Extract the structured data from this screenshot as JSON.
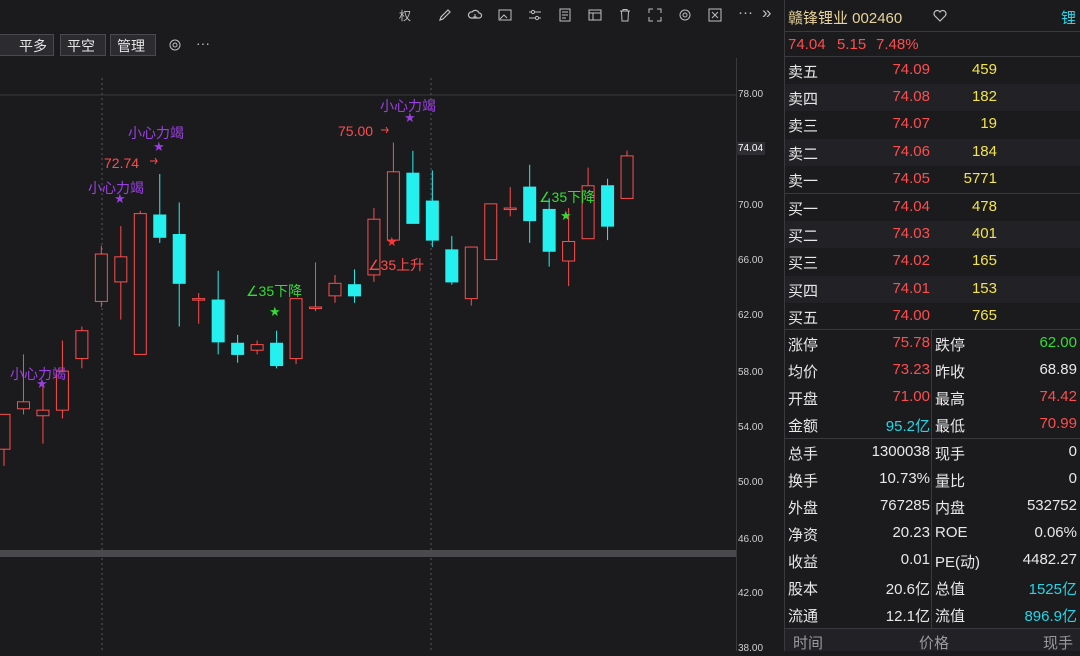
{
  "toolbar": {
    "quan_label": "权",
    "buttons": [
      "平多",
      "平空",
      "管理"
    ],
    "more_label": "···",
    "collapse_label": "»"
  },
  "colors": {
    "up": "#ff4d4d",
    "down": "#25f0f0",
    "signal_purple": "#9b40e0",
    "signal_green": "#33dd33",
    "signal_red": "#ff3333"
  },
  "axis": {
    "ticks": [
      "78.00",
      "74.04",
      "70.00",
      "66.00",
      "62.00",
      "58.00",
      "54.00",
      "50.00",
      "46.00",
      "42.00",
      "38.00"
    ]
  },
  "annotations": [
    {
      "text": "小心力竭",
      "series": "purple"
    },
    {
      "text": "小心力竭",
      "series": "purple"
    },
    {
      "text": "小心力竭",
      "series": "purple"
    },
    {
      "text": "小心力竭",
      "series": "purple"
    },
    {
      "text": "72.74",
      "series": "red"
    },
    {
      "text": "75.00",
      "series": "red"
    },
    {
      "text": "∠35下降",
      "series": "green"
    },
    {
      "text": "∠35下降",
      "series": "green"
    },
    {
      "text": "∠35上升",
      "series": "red"
    }
  ],
  "chart_data": {
    "type": "candlestick",
    "ylim": [
      38,
      80
    ],
    "candles": [
      {
        "o": 53.0,
        "h": 55.0,
        "l": 51.8,
        "c": 55.5
      },
      {
        "o": 55.9,
        "h": 59.8,
        "l": 55.5,
        "c": 56.4
      },
      {
        "o": 55.4,
        "h": 57.5,
        "l": 53.4,
        "c": 55.8
      },
      {
        "o": 55.8,
        "h": 60.8,
        "l": 55.2,
        "c": 58.6
      },
      {
        "o": 59.5,
        "h": 61.8,
        "l": 58.8,
        "c": 61.5
      },
      {
        "o": 63.6,
        "h": 67.6,
        "l": 63.2,
        "c": 67.0
      },
      {
        "o": 65.0,
        "h": 69.0,
        "l": 62.3,
        "c": 66.8
      },
      {
        "o": 59.8,
        "h": 70.1,
        "l": 59.8,
        "c": 69.9
      },
      {
        "o": 69.8,
        "h": 72.74,
        "l": 67.8,
        "c": 68.2
      },
      {
        "o": 68.4,
        "h": 70.7,
        "l": 61.8,
        "c": 64.9
      },
      {
        "o": 63.8,
        "h": 64.2,
        "l": 62.0,
        "c": 63.8
      },
      {
        "o": 63.7,
        "h": 65.8,
        "l": 59.8,
        "c": 60.7
      },
      {
        "o": 60.6,
        "h": 61.2,
        "l": 59.2,
        "c": 59.8
      },
      {
        "o": 60.1,
        "h": 60.8,
        "l": 59.8,
        "c": 60.5
      },
      {
        "o": 60.6,
        "h": 61.5,
        "l": 58.8,
        "c": 59.0
      },
      {
        "o": 59.5,
        "h": 63.8,
        "l": 59.1,
        "c": 63.8
      },
      {
        "o": 63.2,
        "h": 66.4,
        "l": 62.9,
        "c": 63.2
      },
      {
        "o": 64.0,
        "h": 65.5,
        "l": 63.5,
        "c": 64.9
      },
      {
        "o": 64.8,
        "h": 65.9,
        "l": 63.5,
        "c": 64.0
      },
      {
        "o": 65.5,
        "h": 70.3,
        "l": 65.0,
        "c": 69.5
      },
      {
        "o": 68.0,
        "h": 75.0,
        "l": 67.7,
        "c": 72.9
      },
      {
        "o": 72.8,
        "h": 74.4,
        "l": 69.2,
        "c": 69.2
      },
      {
        "o": 70.8,
        "h": 73.0,
        "l": 67.5,
        "c": 68.0
      },
      {
        "o": 67.3,
        "h": 68.3,
        "l": 64.8,
        "c": 65.0
      },
      {
        "o": 63.8,
        "h": 67.5,
        "l": 63.3,
        "c": 67.5
      },
      {
        "o": 66.6,
        "h": 70.6,
        "l": 66.6,
        "c": 70.6
      },
      {
        "o": 70.3,
        "h": 71.8,
        "l": 69.7,
        "c": 70.3
      },
      {
        "o": 71.8,
        "h": 73.4,
        "l": 67.8,
        "c": 69.4
      },
      {
        "o": 70.2,
        "h": 71.0,
        "l": 66.1,
        "c": 67.2
      },
      {
        "o": 66.5,
        "h": 70.3,
        "l": 64.7,
        "c": 67.9
      },
      {
        "o": 68.1,
        "h": 73.2,
        "l": 68.1,
        "c": 71.9
      },
      {
        "o": 71.9,
        "h": 72.4,
        "l": 68.0,
        "c": 69.0
      },
      {
        "o": 70.99,
        "h": 74.42,
        "l": 70.99,
        "c": 74.04
      }
    ]
  },
  "quote": {
    "title": "赣锋锂业 002460",
    "side_label": "锂",
    "price": "74.04",
    "change": "5.15",
    "change_pct": "7.48%",
    "asks": [
      {
        "label": "卖五",
        "price": "74.09",
        "vol": "459"
      },
      {
        "label": "卖四",
        "price": "74.08",
        "vol": "182"
      },
      {
        "label": "卖三",
        "price": "74.07",
        "vol": "19"
      },
      {
        "label": "卖二",
        "price": "74.06",
        "vol": "184"
      },
      {
        "label": "卖一",
        "price": "74.05",
        "vol": "5771"
      }
    ],
    "bids": [
      {
        "label": "买一",
        "price": "74.04",
        "vol": "478"
      },
      {
        "label": "买二",
        "price": "74.03",
        "vol": "401"
      },
      {
        "label": "买三",
        "price": "74.02",
        "vol": "165"
      },
      {
        "label": "买四",
        "price": "74.01",
        "vol": "153"
      },
      {
        "label": "买五",
        "price": "74.00",
        "vol": "765"
      }
    ],
    "stats": [
      {
        "l1": "涨停",
        "v1": "75.78",
        "c1": "red",
        "l2": "跌停",
        "v2": "62.00",
        "c2": "green"
      },
      {
        "l1": "均价",
        "v1": "73.23",
        "c1": "red",
        "l2": "昨收",
        "v2": "68.89",
        "c2": "white"
      },
      {
        "l1": "开盘",
        "v1": "71.00",
        "c1": "red",
        "l2": "最高",
        "v2": "74.42",
        "c2": "red"
      },
      {
        "l1": "金额",
        "v1": "95.2亿",
        "c1": "cyan",
        "l2": "最低",
        "v2": "70.99",
        "c2": "red"
      },
      {
        "l1": "总手",
        "v1": "1300038",
        "c1": "white",
        "l2": "现手",
        "v2": "0",
        "c2": "white"
      },
      {
        "l1": "换手",
        "v1": "10.73%",
        "c1": "white",
        "l2": "量比",
        "v2": "0",
        "c2": "white"
      },
      {
        "l1": "外盘",
        "v1": "767285",
        "c1": "white",
        "l2": "内盘",
        "v2": "532752",
        "c2": "white"
      },
      {
        "l1": "净资",
        "v1": "20.23",
        "c1": "white",
        "l2": "ROE",
        "v2": "0.06%",
        "c2": "white"
      },
      {
        "l1": "收益",
        "v1": "0.01",
        "c1": "white",
        "l2": "PE(动)",
        "v2": "4482.27",
        "c2": "white"
      },
      {
        "l1": "股本",
        "v1": "20.6亿",
        "c1": "white",
        "l2": "总值",
        "v2": "1525亿",
        "c2": "cyan"
      },
      {
        "l1": "流通",
        "v1": "12.1亿",
        "c1": "white",
        "l2": "流值",
        "v2": "896.9亿",
        "c2": "cyan"
      }
    ],
    "footer": {
      "time": "时间",
      "price": "价格",
      "hand": "现手"
    }
  }
}
